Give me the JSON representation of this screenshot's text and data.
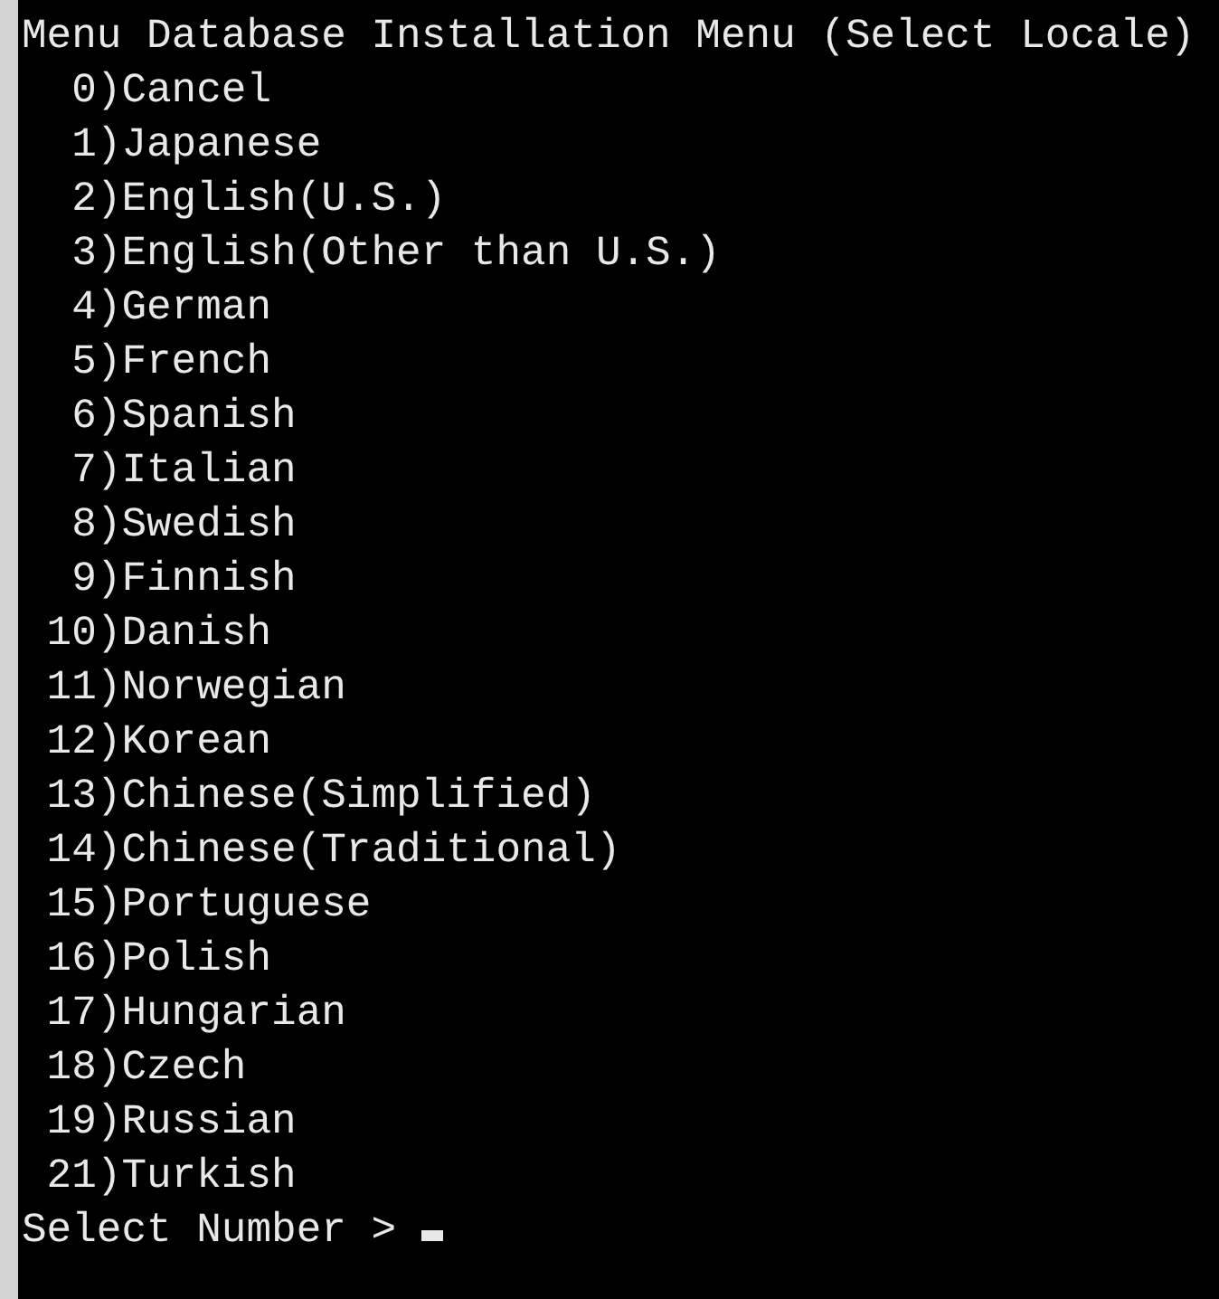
{
  "console": {
    "title": "Menu Database Installation Menu (Select Locale)",
    "options": [
      "0)Cancel",
      "1)Japanese",
      "2)English(U.S.)",
      "3)English(Other than U.S.)",
      "4)German",
      "5)French",
      "6)Spanish",
      "7)Italian",
      "8)Swedish",
      "9)Finnish",
      "10)Danish",
      "11)Norwegian",
      "12)Korean",
      "13)Chinese(Simplified)",
      "14)Chinese(Traditional)",
      "15)Portuguese",
      "16)Polish",
      "17)Hungarian",
      "18)Czech",
      "19)Russian",
      "21)Turkish"
    ],
    "prompt": "Select Number >",
    "cursor": true
  }
}
